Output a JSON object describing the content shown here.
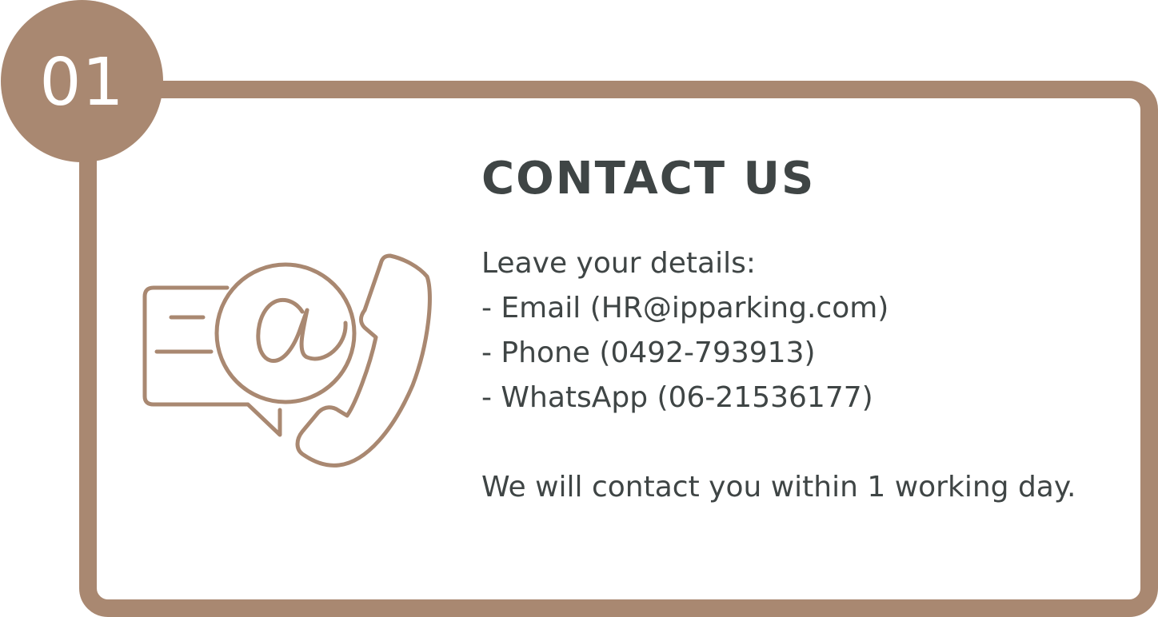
{
  "step": {
    "number": "01"
  },
  "heading": "CONTACT US",
  "details": {
    "intro": "Leave your details:",
    "email": "- Email (HR@ipparking.com)",
    "phone": "- Phone (0492-793913)",
    "whatsapp": "- WhatsApp (06-21536177)"
  },
  "footnote": "We will contact you within 1 working day.",
  "icon": {
    "name": "email-phone-chat-icon"
  },
  "colors": {
    "accent": "#a98871",
    "text": "#3f4545",
    "background": "#ffffff"
  }
}
